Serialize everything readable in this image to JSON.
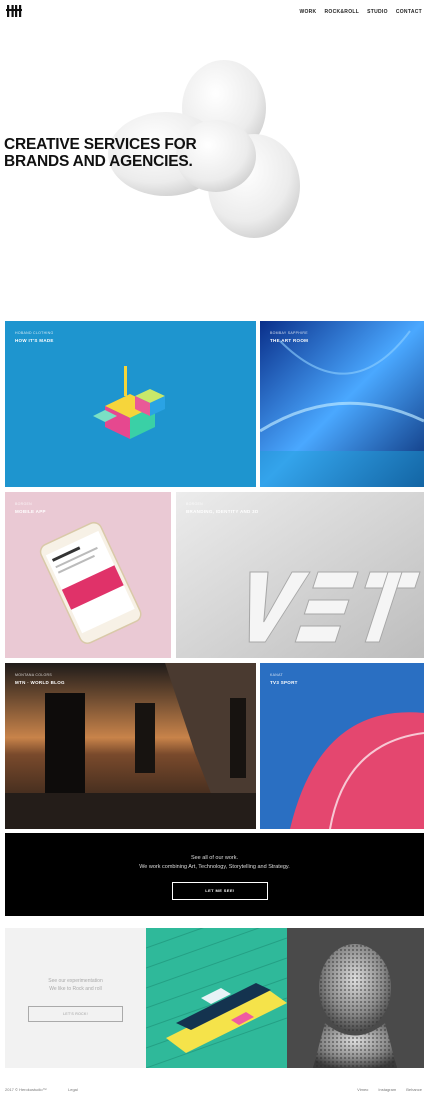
{
  "nav": {
    "logo_icon": "hh-logo-icon",
    "links": [
      "WORK",
      "ROCK&ROLL",
      "STUDIO",
      "CONTACT"
    ]
  },
  "hero": {
    "title_line1": "CREATIVE SERVICES FOR",
    "title_line2": "BRANDS AND AGENCIES."
  },
  "projects": [
    {
      "category": "HOBAND CLOTHING",
      "title": "HOW IT'S MADE",
      "bg": "#1e95cf"
    },
    {
      "category": "BOMBAY SAPPHIRE",
      "title": "THE ART ROOM",
      "bg": "#0b3a9a"
    },
    {
      "category": "BORGEN",
      "title": "MOBILE APP",
      "bg": "#eac9d4"
    },
    {
      "category": "BORGEN",
      "title": "BRANDING, IDENTITY AND 3D",
      "bg": "#d6d6d6"
    },
    {
      "category": "MONTANA COLORS",
      "title": "MTN · WORLD BLOG",
      "bg": "#3a3532"
    },
    {
      "category": "KANAT",
      "title": "TV3 SPORT",
      "bg": "#2a6fc2"
    }
  ],
  "cta": {
    "line1": "See all of our work.",
    "line2": "We work combining Art, Technology, Storytelling and Strategy.",
    "button": "LET ME SEE!"
  },
  "experimentation": {
    "line1": "See our experimentation",
    "line2": "We like to Rock and roll",
    "button": "LET'S ROCK!"
  },
  "footer": {
    "copyright": "2017 © Herokustudio™",
    "legal": "Legal",
    "social": [
      "Vimeo",
      "Instagram",
      "Behance"
    ]
  }
}
